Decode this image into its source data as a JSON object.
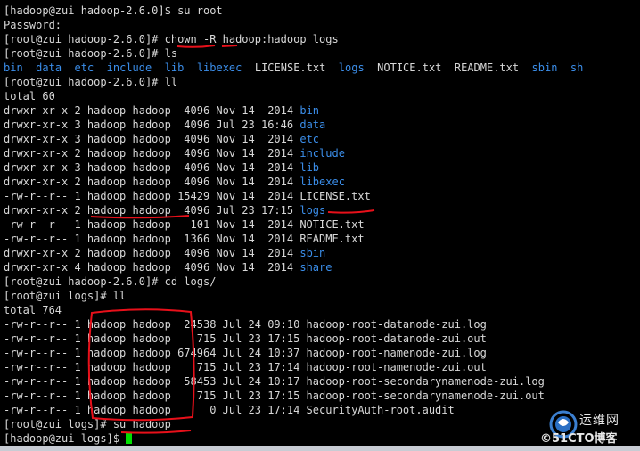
{
  "terminal": {
    "lines": [
      {
        "segs": [
          {
            "t": "[hadoop@zui hadoop-2.6.0]$ su root",
            "c": "w"
          }
        ]
      },
      {
        "segs": [
          {
            "t": "Password:",
            "c": "w"
          }
        ]
      },
      {
        "segs": [
          {
            "t": "[root@zui hadoop-2.6.0]# chown -R hadoop:hadoop logs",
            "c": "w"
          }
        ]
      },
      {
        "segs": [
          {
            "t": "[root@zui hadoop-2.6.0]# ls",
            "c": "w"
          }
        ]
      },
      {
        "segs": [
          {
            "t": "bin",
            "c": "b"
          },
          {
            "t": "  ",
            "c": "w"
          },
          {
            "t": "data",
            "c": "b"
          },
          {
            "t": "  ",
            "c": "w"
          },
          {
            "t": "etc",
            "c": "b"
          },
          {
            "t": "  ",
            "c": "w"
          },
          {
            "t": "include",
            "c": "b"
          },
          {
            "t": "  ",
            "c": "w"
          },
          {
            "t": "lib",
            "c": "b"
          },
          {
            "t": "  ",
            "c": "w"
          },
          {
            "t": "libexec",
            "c": "b"
          },
          {
            "t": "  ",
            "c": "w"
          },
          {
            "t": "LICENSE.txt",
            "c": "w"
          },
          {
            "t": "  ",
            "c": "w"
          },
          {
            "t": "logs",
            "c": "b"
          },
          {
            "t": "  ",
            "c": "w"
          },
          {
            "t": "NOTICE.txt",
            "c": "w"
          },
          {
            "t": "  ",
            "c": "w"
          },
          {
            "t": "README.txt",
            "c": "w"
          },
          {
            "t": "  ",
            "c": "w"
          },
          {
            "t": "sbin",
            "c": "b"
          },
          {
            "t": "  ",
            "c": "w"
          },
          {
            "t": "sh",
            "c": "b"
          }
        ]
      },
      {
        "segs": [
          {
            "t": "[root@zui hadoop-2.6.0]# ll",
            "c": "w"
          }
        ]
      },
      {
        "segs": [
          {
            "t": "total 60",
            "c": "w"
          }
        ]
      },
      {
        "segs": [
          {
            "t": "drwxr-xr-x 2 hadoop hadoop  4096 Nov 14  2014 ",
            "c": "w"
          },
          {
            "t": "bin",
            "c": "b"
          }
        ]
      },
      {
        "segs": [
          {
            "t": "drwxr-xr-x 3 hadoop hadoop  4096 Jul 23 16:46 ",
            "c": "w"
          },
          {
            "t": "data",
            "c": "b"
          }
        ]
      },
      {
        "segs": [
          {
            "t": "drwxr-xr-x 3 hadoop hadoop  4096 Nov 14  2014 ",
            "c": "w"
          },
          {
            "t": "etc",
            "c": "b"
          }
        ]
      },
      {
        "segs": [
          {
            "t": "drwxr-xr-x 2 hadoop hadoop  4096 Nov 14  2014 ",
            "c": "w"
          },
          {
            "t": "include",
            "c": "b"
          }
        ]
      },
      {
        "segs": [
          {
            "t": "drwxr-xr-x 3 hadoop hadoop  4096 Nov 14  2014 ",
            "c": "w"
          },
          {
            "t": "lib",
            "c": "b"
          }
        ]
      },
      {
        "segs": [
          {
            "t": "drwxr-xr-x 2 hadoop hadoop  4096 Nov 14  2014 ",
            "c": "w"
          },
          {
            "t": "libexec",
            "c": "b"
          }
        ]
      },
      {
        "segs": [
          {
            "t": "-rw-r--r-- 1 hadoop hadoop 15429 Nov 14  2014 LICENSE.txt",
            "c": "w"
          }
        ]
      },
      {
        "segs": [
          {
            "t": "drwxr-xr-x 2 hadoop hadoop  4096 Jul 23 17:15 ",
            "c": "w"
          },
          {
            "t": "logs",
            "c": "b"
          }
        ]
      },
      {
        "segs": [
          {
            "t": "-rw-r--r-- 1 hadoop hadoop   101 Nov 14  2014 NOTICE.txt",
            "c": "w"
          }
        ]
      },
      {
        "segs": [
          {
            "t": "-rw-r--r-- 1 hadoop hadoop  1366 Nov 14  2014 README.txt",
            "c": "w"
          }
        ]
      },
      {
        "segs": [
          {
            "t": "drwxr-xr-x 2 hadoop hadoop  4096 Nov 14  2014 ",
            "c": "w"
          },
          {
            "t": "sbin",
            "c": "b"
          }
        ]
      },
      {
        "segs": [
          {
            "t": "drwxr-xr-x 4 hadoop hadoop  4096 Nov 14  2014 ",
            "c": "w"
          },
          {
            "t": "share",
            "c": "b"
          }
        ]
      },
      {
        "segs": [
          {
            "t": "[root@zui hadoop-2.6.0]# cd logs/",
            "c": "w"
          }
        ]
      },
      {
        "segs": [
          {
            "t": "[root@zui logs]# ll",
            "c": "w"
          }
        ]
      },
      {
        "segs": [
          {
            "t": "total 764",
            "c": "w"
          }
        ]
      },
      {
        "segs": [
          {
            "t": "-rw-r--r-- 1 hadoop hadoop  24538 Jul 24 09:10 hadoop-root-datanode-zui.log",
            "c": "w"
          }
        ]
      },
      {
        "segs": [
          {
            "t": "-rw-r--r-- 1 hadoop hadoop    715 Jul 23 17:15 hadoop-root-datanode-zui.out",
            "c": "w"
          }
        ]
      },
      {
        "segs": [
          {
            "t": "-rw-r--r-- 1 hadoop hadoop 674964 Jul 24 10:37 hadoop-root-namenode-zui.log",
            "c": "w"
          }
        ]
      },
      {
        "segs": [
          {
            "t": "-rw-r--r-- 1 hadoop hadoop    715 Jul 23 17:14 hadoop-root-namenode-zui.out",
            "c": "w"
          }
        ]
      },
      {
        "segs": [
          {
            "t": "-rw-r--r-- 1 hadoop hadoop  58453 Jul 24 10:17 hadoop-root-secondarynamenode-zui.log",
            "c": "w"
          }
        ]
      },
      {
        "segs": [
          {
            "t": "-rw-r--r-- 1 hadoop hadoop    715 Jul 23 17:15 hadoop-root-secondarynamenode-zui.out",
            "c": "w"
          }
        ]
      },
      {
        "segs": [
          {
            "t": "-rw-r--r-- 1 hadoop hadoop      0 Jul 23 17:14 SecurityAuth-root.audit",
            "c": "w"
          }
        ]
      },
      {
        "segs": [
          {
            "t": "[root@zui logs]# su hadoop",
            "c": "w"
          }
        ]
      },
      {
        "segs": [
          {
            "t": "[hadoop@zui logs]$ ",
            "c": "w"
          }
        ],
        "cursor": true
      }
    ]
  },
  "colors": {
    "background": "#000000",
    "text": "#d8d8d8",
    "directory": "#3b8eea",
    "cursor": "#00e000",
    "annotation": "#e8101a"
  },
  "watermark": {
    "icon": "51cto-logo-icon",
    "text1": "运维网",
    "text2": "©51CTO博客"
  }
}
